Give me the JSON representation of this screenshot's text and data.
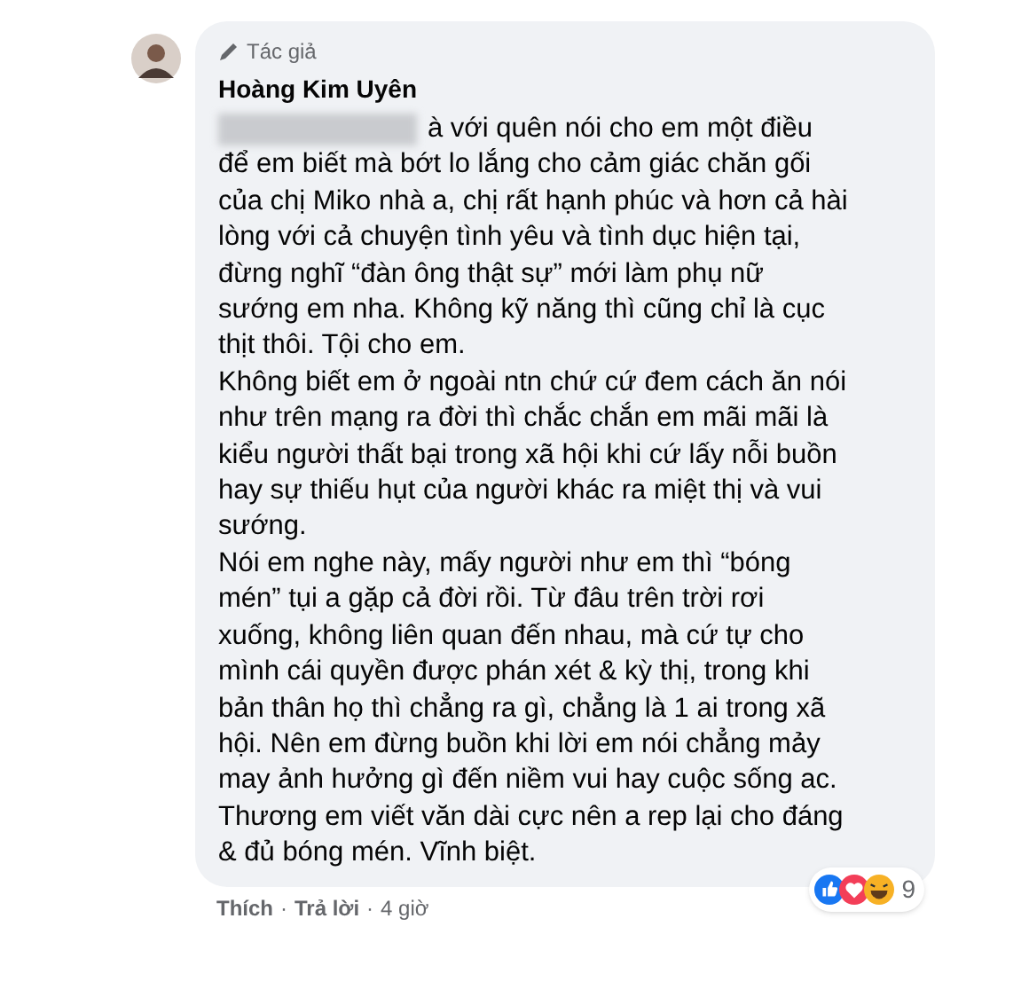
{
  "comment": {
    "badge": "Tác giả",
    "author": "Hoàng Kim Uyên",
    "paragraphs": [
      {
        "redacted_start": true,
        "lines": [
          "à với quên nói cho em một điều",
          "để em biết mà bớt lo lắng cho cảm giác chăn gối",
          "của chị Miko nhà a, chị rất hạnh phúc và hơn cả hài",
          "lòng với cả chuyện tình yêu và tình dục hiện tại,",
          "đừng nghĩ “đàn ông thật sự” mới làm phụ nữ",
          "sướng em nha. Không kỹ năng thì cũng chỉ là cục",
          "thịt thôi. Tội cho em."
        ]
      },
      {
        "redacted_start": false,
        "lines": [
          "Không biết em ở ngoài ntn chứ cứ đem cách ăn nói",
          "như trên mạng ra đời thì chắc chắn em mãi mãi là",
          "kiểu người thất bại trong xã hội khi cứ lấy nỗi buồn",
          "hay sự thiếu hụt của người khác ra miệt thị và vui",
          "sướng."
        ]
      },
      {
        "redacted_start": false,
        "lines": [
          "Nói em nghe này, mấy người như em thì “bóng",
          "mén” tụi a gặp cả đời rồi. Từ đâu trên trời rơi",
          "xuống, không liên quan đến nhau, mà cứ tự cho",
          "mình cái quyền được phán xét & kỳ thị, trong khi",
          "bản thân họ thì chẳng ra gì, chẳng là 1 ai trong xã",
          "hội. Nên em đừng buồn khi lời em nói chẳng mảy",
          "may ảnh hưởng gì đến niềm vui hay cuộc sống ac.",
          "Thương em viết văn dài cực nên a rep lại cho đáng",
          "& đủ bóng mén. Vĩnh biệt."
        ]
      }
    ],
    "reaction_count": "9",
    "separators": [
      "·",
      "·"
    ],
    "actions": [
      {
        "kind": "link",
        "label": "Thích"
      },
      {
        "kind": "link",
        "label": "Trả lời"
      },
      {
        "kind": "time",
        "label": "4 giờ"
      }
    ]
  }
}
